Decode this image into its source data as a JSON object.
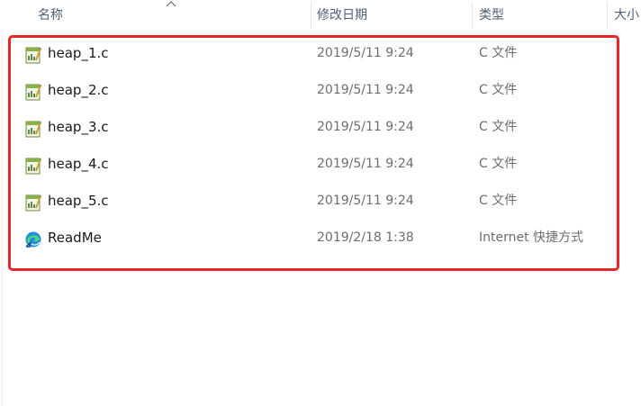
{
  "columns": {
    "name": "名称",
    "date": "修改日期",
    "type": "类型",
    "size": "大小"
  },
  "sort": {
    "column": "name",
    "direction": "ascending",
    "icon": "chevron-up-icon"
  },
  "files": [
    {
      "name": "heap_1.c",
      "date": "2019/5/11 9:24",
      "type": "C 文件",
      "icon": "c-source-file-icon"
    },
    {
      "name": "heap_2.c",
      "date": "2019/5/11 9:24",
      "type": "C 文件",
      "icon": "c-source-file-icon"
    },
    {
      "name": "heap_3.c",
      "date": "2019/5/11 9:24",
      "type": "C 文件",
      "icon": "c-source-file-icon"
    },
    {
      "name": "heap_4.c",
      "date": "2019/5/11 9:24",
      "type": "C 文件",
      "icon": "c-source-file-icon"
    },
    {
      "name": "heap_5.c",
      "date": "2019/5/11 9:24",
      "type": "C 文件",
      "icon": "c-source-file-icon"
    },
    {
      "name": "ReadMe",
      "date": "2019/2/18 1:38",
      "type": "Internet 快捷方式",
      "icon": "edge-shortcut-icon"
    }
  ],
  "colors": {
    "highlight": "#e8262a",
    "header_text": "#4c607a",
    "meta_text": "#6d6d6d"
  }
}
